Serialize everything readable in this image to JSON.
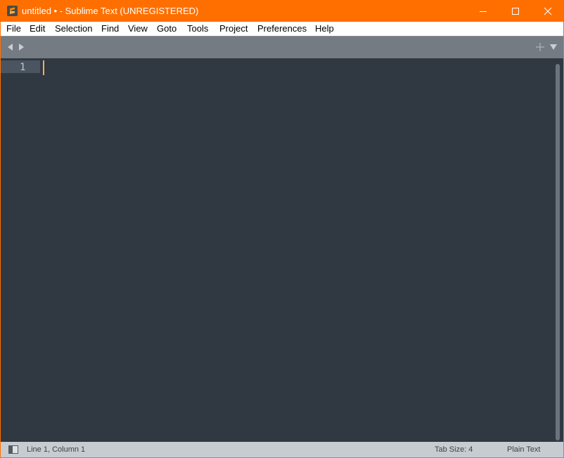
{
  "window": {
    "title": "untitled • - Sublime Text (UNREGISTERED)",
    "accent_color": "#ff6f00"
  },
  "menu": {
    "items": [
      "File",
      "Edit",
      "Selection",
      "Find",
      "View",
      "Goto",
      "Tools",
      "Project",
      "Preferences",
      "Help"
    ]
  },
  "tabstrip": {
    "icons": [
      "chevron-left-icon",
      "chevron-right-icon",
      "plus-icon",
      "triangle-down-icon"
    ]
  },
  "editor": {
    "line_numbers": [
      "1"
    ],
    "content": "",
    "background_color": "#303841",
    "caret_color": "#f9ae58"
  },
  "statusbar": {
    "position": "Line 1, Column 1",
    "tab_size": "Tab Size: 4",
    "syntax": "Plain Text"
  }
}
